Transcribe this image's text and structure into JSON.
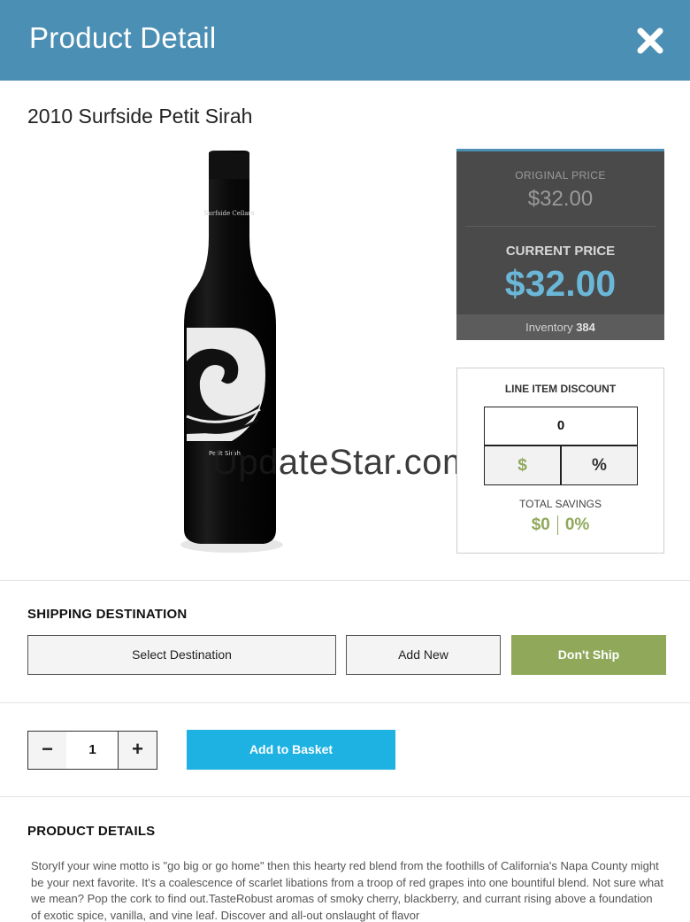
{
  "header": {
    "title": "Product Detail",
    "close_icon": "close-icon",
    "bg_color": "#4c8fb4"
  },
  "product": {
    "title": "2010 Surfside Petit Sirah",
    "bottle_label_brand": "Surfside Cellars",
    "bottle_label_varietal": "Petit Sirah"
  },
  "watermark": "UpdateStar.com",
  "pricing": {
    "original_label": "ORIGINAL PRICE",
    "original_price": "$32.00",
    "current_label": "CURRENT PRICE",
    "current_price": "$32.00",
    "inventory_label": "Inventory",
    "inventory_count": "384",
    "accent_color": "#6ab7d8"
  },
  "discount": {
    "label": "LINE ITEM DISCOUNT",
    "value": "0",
    "dollar_label": "$",
    "percent_label": "%",
    "savings_label": "TOTAL SAVINGS",
    "savings_amount": "$0",
    "savings_percent": "0%",
    "savings_color": "#8fa85a"
  },
  "shipping": {
    "title": "SHIPPING DESTINATION",
    "select_label": "Select Destination",
    "add_new_label": "Add New",
    "dont_ship_label": "Don't Ship"
  },
  "quantity": {
    "minus_label": "−",
    "value": "1",
    "plus_label": "+"
  },
  "basket": {
    "add_label": "Add to Basket",
    "color": "#1eb2e3"
  },
  "details": {
    "title": "PRODUCT DETAILS",
    "text": "StoryIf your wine motto is \"go big or go home\" then this hearty red blend from the foothills of California's Napa County might be your next favorite. It's a coalescence of scarlet libations from a troop of red grapes into one bountiful blend. Not sure what we mean? Pop the cork to find out.TasteRobust aromas of smoky cherry, blackberry, and currant rising above a foundation of exotic spice, vanilla, and vine leaf. Discover and all-out onslaught of flavor"
  }
}
